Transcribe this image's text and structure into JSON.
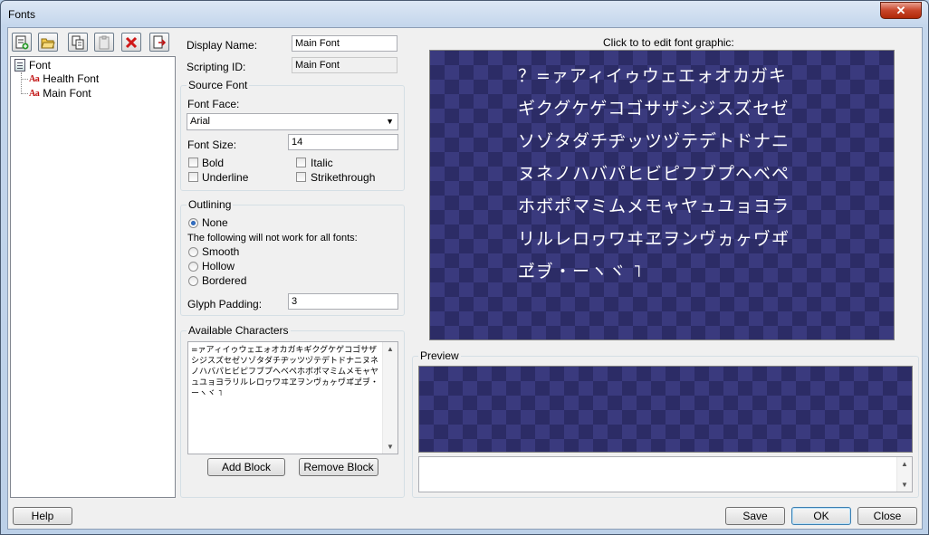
{
  "window": {
    "title": "Fonts",
    "close_glyph": "✕"
  },
  "toolbar": {
    "buttons": [
      {
        "name": "new-font-icon"
      },
      {
        "name": "open-folder-icon"
      },
      {
        "name": "copy-icon"
      },
      {
        "name": "paste-icon"
      },
      {
        "name": "delete-icon"
      },
      {
        "name": "export-icon"
      }
    ]
  },
  "tree": {
    "root": "Font",
    "icon_label": "Aa",
    "children": [
      "Health Font",
      "Main Font"
    ]
  },
  "props": {
    "display_name_label": "Display Name:",
    "display_name": "Main Font",
    "scripting_id_label": "Scripting ID:",
    "scripting_id": "Main Font"
  },
  "source_font": {
    "title": "Source Font",
    "face_label": "Font Face:",
    "face": "Arial",
    "size_label": "Font Size:",
    "size": "14",
    "bold": "Bold",
    "italic": "Italic",
    "underline": "Underline",
    "strikethrough": "Strikethrough"
  },
  "outlining": {
    "title": "Outlining",
    "none": "None",
    "note": "The following will not work for all fonts:",
    "smooth": "Smooth",
    "hollow": "Hollow",
    "bordered": "Bordered",
    "padding_label": "Glyph Padding:",
    "padding": "3",
    "selected": "None"
  },
  "chars": {
    "title": "Available Characters",
    "text": "=ァアィイゥウェエォオカガキギクグケゲコゴサザシジスズセゼソゾタダチヂッツヅテデトドナニヌネノハバパヒビピフブプヘベペホボポマミムメモャヤュユョヨラリルレロヮワヰヱヲンヴヵヶヷヸヹヺ・ーヽヾ ˥",
    "add_block": "Add Block",
    "remove_block": "Remove Block"
  },
  "graphic": {
    "caption": "Click to to edit font graphic:",
    "rows": [
      "？=ァアィイゥウェエォオカガキ",
      "ギクグケゲコゴサザシジスズセゼ",
      "ソゾタダチヂッツヅテデトドナニ",
      "ヌネノハバパヒビピフブプヘベペ",
      "ホボポマミムメモャヤュユョヨラ",
      "リルレロヮワヰヱヲンヴヵヶヷヸ",
      "ヹヺ・ーヽヾ ˥"
    ]
  },
  "preview": {
    "title": "Preview"
  },
  "footer": {
    "help": "Help",
    "save": "Save",
    "ok": "OK",
    "close": "Close"
  }
}
